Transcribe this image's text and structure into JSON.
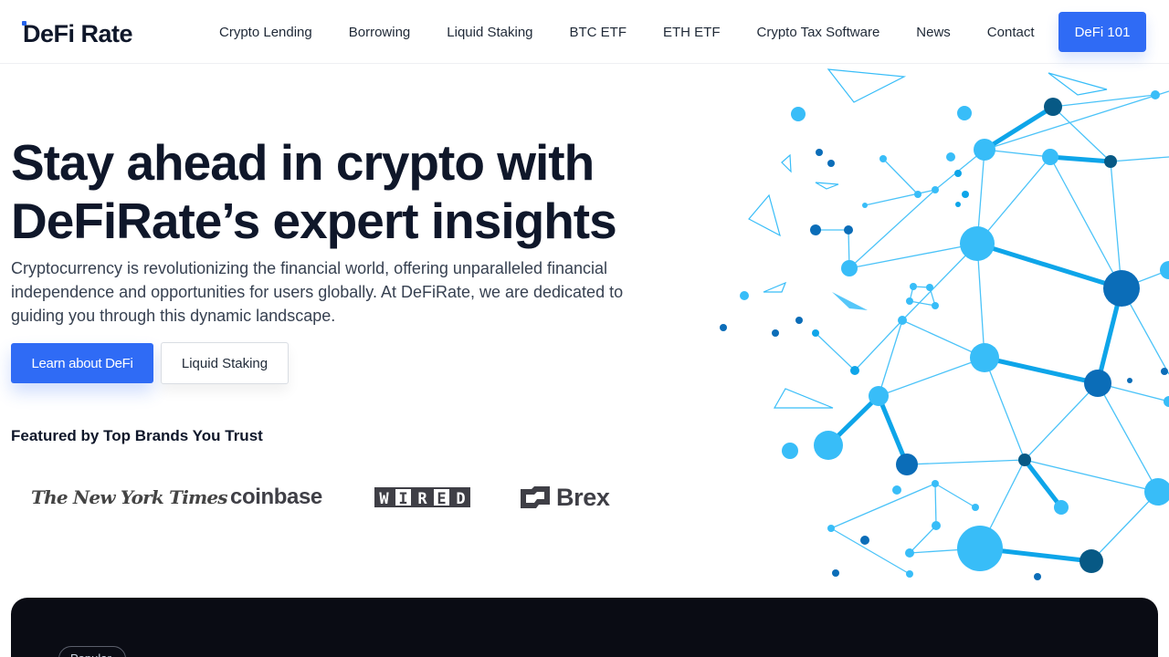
{
  "header": {
    "logo": "DeFi Rate",
    "nav": [
      {
        "label": "Crypto Lending"
      },
      {
        "label": "Borrowing"
      },
      {
        "label": "Liquid Staking"
      },
      {
        "label": "BTC ETF"
      },
      {
        "label": "ETH ETF"
      },
      {
        "label": "Crypto Tax Software"
      },
      {
        "label": "News"
      },
      {
        "label": "Contact"
      }
    ],
    "cta": "DeFi 101"
  },
  "hero": {
    "title_line1": "Stay ahead in crypto with",
    "title_line2": "DeFiRate’s expert insights",
    "description": "Cryptocurrency is revolutionizing the financial world, offering unparalleled financial independence and opportunities for users globally. At DeFiRate, we are dedicated to guiding you through this dynamic landscape.",
    "primary_button": "Learn about DeFi",
    "secondary_button": "Liquid Staking"
  },
  "featured": {
    "heading": "Featured by Top Brands You Trust",
    "brands": {
      "nyt": "The New York Times",
      "coinbase": "coinbase",
      "wired": [
        "W",
        "I",
        "R",
        "E",
        "D"
      ],
      "brex": "Brex"
    }
  },
  "dark_section": {
    "chip": "Popular"
  },
  "colors": {
    "accent": "#2f6bf5",
    "text_dark": "#0f172a",
    "network_light": "#38bdf8",
    "network_mid": "#0ea5e9",
    "network_dark": "#075985",
    "dark_bg": "#0a0c14"
  },
  "icons": {
    "network_graphic": "blockchain-network-illustration",
    "brex_mark": "brex-logo-mark"
  }
}
